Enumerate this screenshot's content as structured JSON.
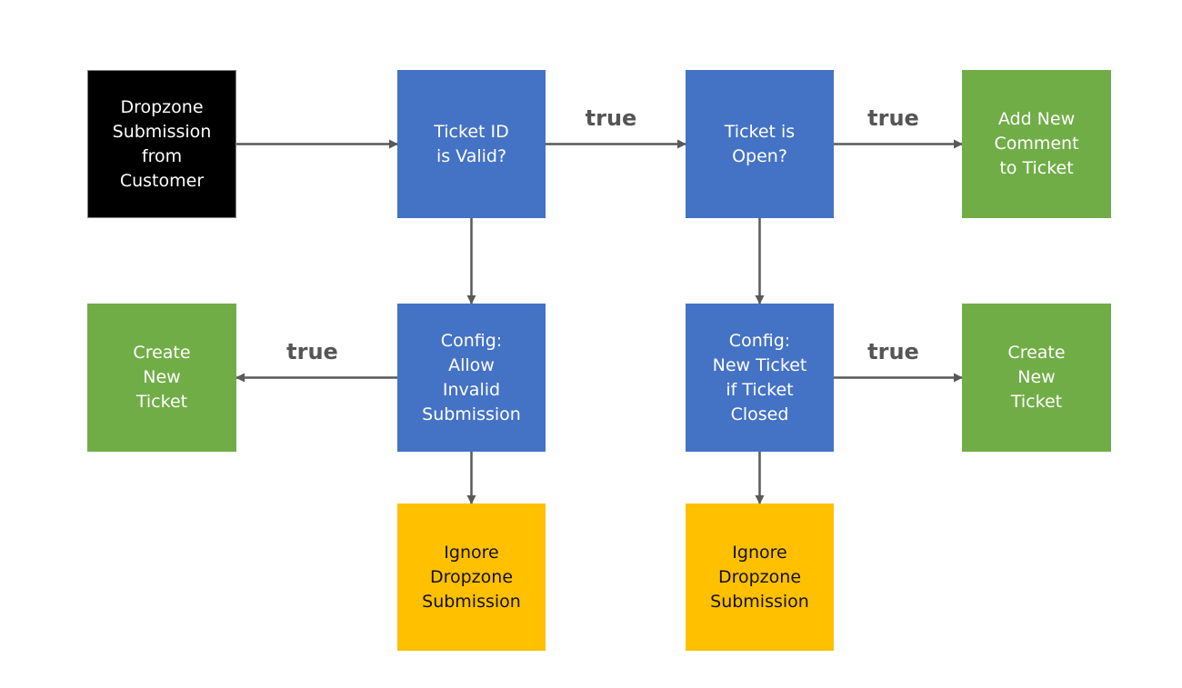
{
  "colors": {
    "start": "#000000",
    "decision": "#4472C4",
    "action": "#70AD47",
    "ignore": "#FFC000",
    "arrow": "#595959",
    "start_border": "#7f7f7f"
  },
  "nodes": {
    "start": {
      "label": "Dropzone\nSubmission\nfrom\nCustomer",
      "type": "start"
    },
    "ticket_valid": {
      "label": "Ticket ID\nis Valid?",
      "type": "decision"
    },
    "ticket_open": {
      "label": "Ticket is\nOpen?",
      "type": "decision"
    },
    "add_comment": {
      "label": "Add New\nComment\nto Ticket",
      "type": "action"
    },
    "create_ticket_left": {
      "label": "Create\nNew\nTicket",
      "type": "action"
    },
    "allow_invalid": {
      "label": "Config:\nAllow\nInvalid\nSubmission",
      "type": "decision"
    },
    "new_if_closed": {
      "label": "Config:\nNew Ticket\nif Ticket\nClosed",
      "type": "decision"
    },
    "create_ticket_right": {
      "label": "Create\nNew\nTicket",
      "type": "action"
    },
    "ignore_left": {
      "label": "Ignore\nDropzone\nSubmission",
      "type": "ignore"
    },
    "ignore_right": {
      "label": "Ignore\nDropzone\nSubmission",
      "type": "ignore"
    }
  },
  "edges": [
    {
      "from": "start",
      "to": "ticket_valid",
      "label": ""
    },
    {
      "from": "ticket_valid",
      "to": "ticket_open",
      "label": "true"
    },
    {
      "from": "ticket_open",
      "to": "add_comment",
      "label": "true"
    },
    {
      "from": "ticket_valid",
      "to": "allow_invalid",
      "label": ""
    },
    {
      "from": "ticket_open",
      "to": "new_if_closed",
      "label": ""
    },
    {
      "from": "allow_invalid",
      "to": "create_ticket_left",
      "label": "true"
    },
    {
      "from": "new_if_closed",
      "to": "create_ticket_right",
      "label": "true"
    },
    {
      "from": "allow_invalid",
      "to": "ignore_left",
      "label": ""
    },
    {
      "from": "new_if_closed",
      "to": "ignore_right",
      "label": ""
    }
  ]
}
